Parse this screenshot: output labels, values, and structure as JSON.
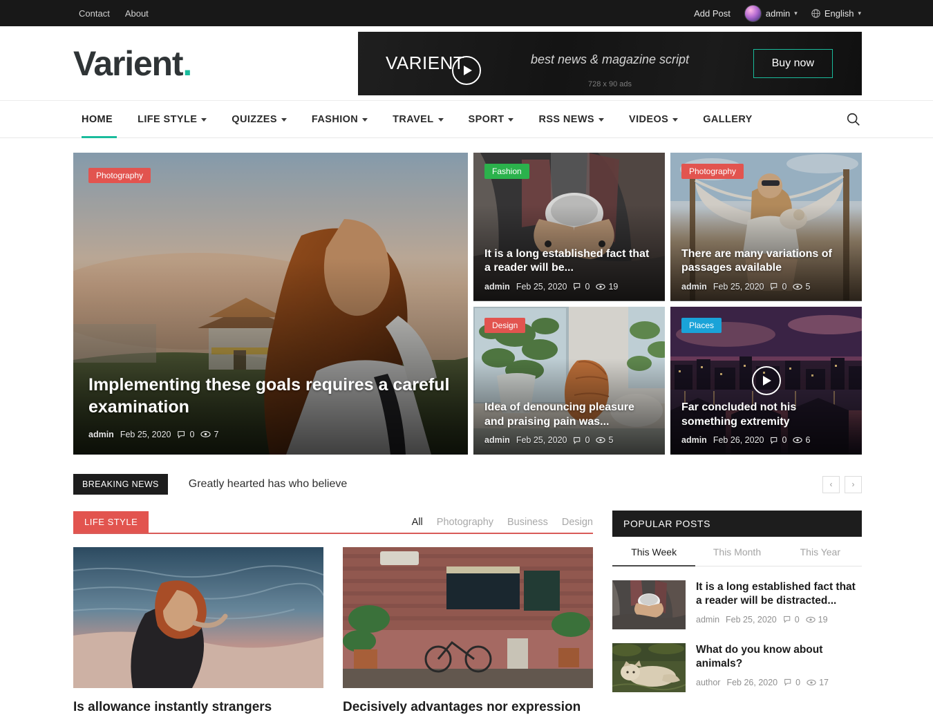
{
  "topbar": {
    "links": [
      {
        "label": "Contact"
      },
      {
        "label": "About"
      }
    ],
    "add_post": "Add Post",
    "user": "admin",
    "language": "English"
  },
  "header": {
    "logo": "Varient",
    "logo_dot": ".",
    "ad": {
      "logo": "VARIENT",
      "logo_dot": ".",
      "tagline": "best news & magazine script",
      "size_label": "728 x 90 ads",
      "button": "Buy now",
      "accent": "#1abc9c"
    }
  },
  "nav": {
    "items": [
      {
        "label": "HOME",
        "caret": false,
        "active": true
      },
      {
        "label": "LIFE STYLE",
        "caret": true,
        "active": false
      },
      {
        "label": "QUIZZES",
        "caret": true,
        "active": false
      },
      {
        "label": "FASHION",
        "caret": true,
        "active": false
      },
      {
        "label": "TRAVEL",
        "caret": true,
        "active": false
      },
      {
        "label": "SPORT",
        "caret": true,
        "active": false
      },
      {
        "label": "RSS NEWS",
        "caret": true,
        "active": false
      },
      {
        "label": "VIDEOS",
        "caret": true,
        "active": false
      },
      {
        "label": "GALLERY",
        "caret": false,
        "active": false
      }
    ],
    "active_color": "#1abc9c"
  },
  "hero": {
    "main": {
      "category": "Photography",
      "category_color": "#e2544f",
      "title": "Implementing these goals requires a careful examination",
      "author": "admin",
      "date": "Feb 25, 2020",
      "comments": "0",
      "views": "7"
    },
    "cells": [
      {
        "category": "Fashion",
        "category_color": "#2bb24c",
        "title": "It is a long established fact that a reader will be...",
        "author": "admin",
        "date": "Feb 25, 2020",
        "comments": "0",
        "views": "19",
        "has_video": false
      },
      {
        "category": "Photography",
        "category_color": "#e2544f",
        "title": "There are many variations of passages available",
        "author": "admin",
        "date": "Feb 25, 2020",
        "comments": "0",
        "views": "5",
        "has_video": false
      },
      {
        "category": "Design",
        "category_color": "#e2544f",
        "title": "Idea of denouncing pleasure and praising pain was...",
        "author": "admin",
        "date": "Feb 25, 2020",
        "comments": "0",
        "views": "5",
        "has_video": false
      },
      {
        "category": "Places",
        "category_color": "#1aa3d8",
        "title": "Far concluded not his something extremity",
        "author": "admin",
        "date": "Feb 26, 2020",
        "comments": "0",
        "views": "6",
        "has_video": true
      }
    ]
  },
  "breaking": {
    "tag": "BREAKING NEWS",
    "headline": "Greatly hearted has who believe",
    "prev": "‹",
    "next": "›"
  },
  "lifestyle": {
    "section_label": "LIFE STYLE",
    "section_color": "#e2544f",
    "tabs": [
      {
        "label": "All",
        "active": true
      },
      {
        "label": "Photography",
        "active": false
      },
      {
        "label": "Business",
        "active": false
      },
      {
        "label": "Design",
        "active": false
      }
    ],
    "posts": [
      {
        "title": "Is allowance instantly strangers",
        "has_video": false
      },
      {
        "title": "Decisively advantages nor expression",
        "has_video": true
      }
    ]
  },
  "popular": {
    "heading": "POPULAR POSTS",
    "tabs": [
      {
        "label": "This Week",
        "active": true
      },
      {
        "label": "This Month",
        "active": false
      },
      {
        "label": "This Year",
        "active": false
      }
    ],
    "items": [
      {
        "title": "It is a long established fact that a reader will be distracted...",
        "author": "admin",
        "date": "Feb 25, 2020",
        "comments": "0",
        "views": "19"
      },
      {
        "title": "What do you know about animals?",
        "author": "author",
        "date": "Feb 26, 2020",
        "comments": "0",
        "views": "17"
      }
    ]
  }
}
